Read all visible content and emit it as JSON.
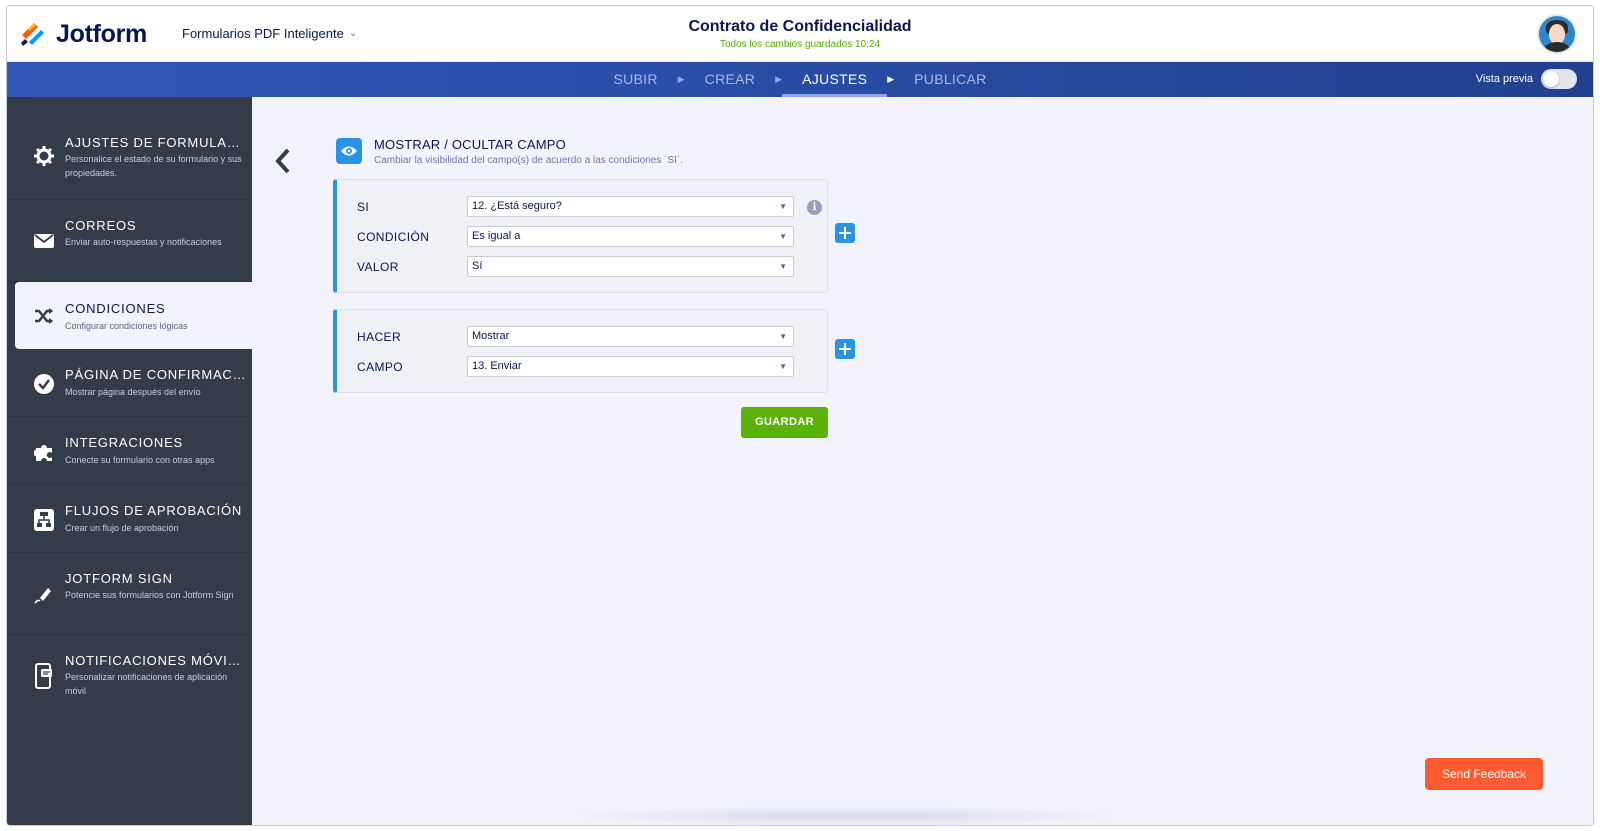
{
  "header": {
    "brand": "Jotform",
    "product": "Formularios PDF Inteligente",
    "document_title": "Contrato de Confidencialidad",
    "save_status": "Todos los cambios guardados 10:24"
  },
  "nav": {
    "steps": [
      "SUBIR",
      "CREAR",
      "AJUSTES",
      "PUBLICAR"
    ],
    "active_step": "AJUSTES",
    "preview_label": "Vista previa",
    "preview_enabled": false
  },
  "sidebar": {
    "items": [
      {
        "title": "AJUSTES DE FORMULARIO",
        "desc": "Personalice el estado de su formulario y sus propiedades.",
        "icon": "gear-icon"
      },
      {
        "title": "CORREOS",
        "desc": "Enviar auto-respuestas y notificaciones",
        "icon": "envelope-icon"
      },
      {
        "title": "CONDICIONES",
        "desc": "Configurar condiciones lógicas",
        "icon": "shuffle-icon"
      },
      {
        "title": "PÁGINA DE CONFIRMACIÓN",
        "desc": "Mostrar página después del envío",
        "icon": "check-circle-icon"
      },
      {
        "title": "INTEGRACIONES",
        "desc": "Conecte su formulario con otras apps",
        "icon": "puzzle-icon"
      },
      {
        "title": "FLUJOS DE APROBACIÓN",
        "desc": "Crear un flujo de aprobación",
        "icon": "flowchart-icon"
      },
      {
        "title": "JOTFORM SIGN",
        "desc": "Potencie sus formularios con Jotform Sign",
        "icon": "pen-icon"
      },
      {
        "title": "NOTIFICACIONES MÓVILES",
        "desc": "Personalizar notificaciones de aplicación móvil",
        "icon": "mobile-icon"
      }
    ],
    "active_index": 2
  },
  "condition": {
    "title": "MOSTRAR / OCULTAR CAMPO",
    "subtitle": "Cambiar la visibilidad del campo(s) de acuerdo a las condiciones `SI`.",
    "if_block": {
      "if_label": "SI",
      "if_value": "12. ¿Está seguro?",
      "condition_label": "CONDICIÓN",
      "condition_value": "Es igual a",
      "value_label": "VALOR",
      "value_value": "Sí"
    },
    "do_block": {
      "do_label": "HACER",
      "do_value": "Mostrar",
      "field_label": "CAMPO",
      "field_value": "13. Enviar"
    },
    "save_label": "GUARDAR"
  },
  "feedback_label": "Send Feedback",
  "colors": {
    "brand_navy": "#0a1551",
    "nav_blue": "#2c4a9a",
    "sidebar_bg": "#343c4a",
    "accent_blue": "#2a93e5",
    "save_green": "#5db10b",
    "feedback_orange": "#ff5b31",
    "status_green": "#4cb000"
  }
}
